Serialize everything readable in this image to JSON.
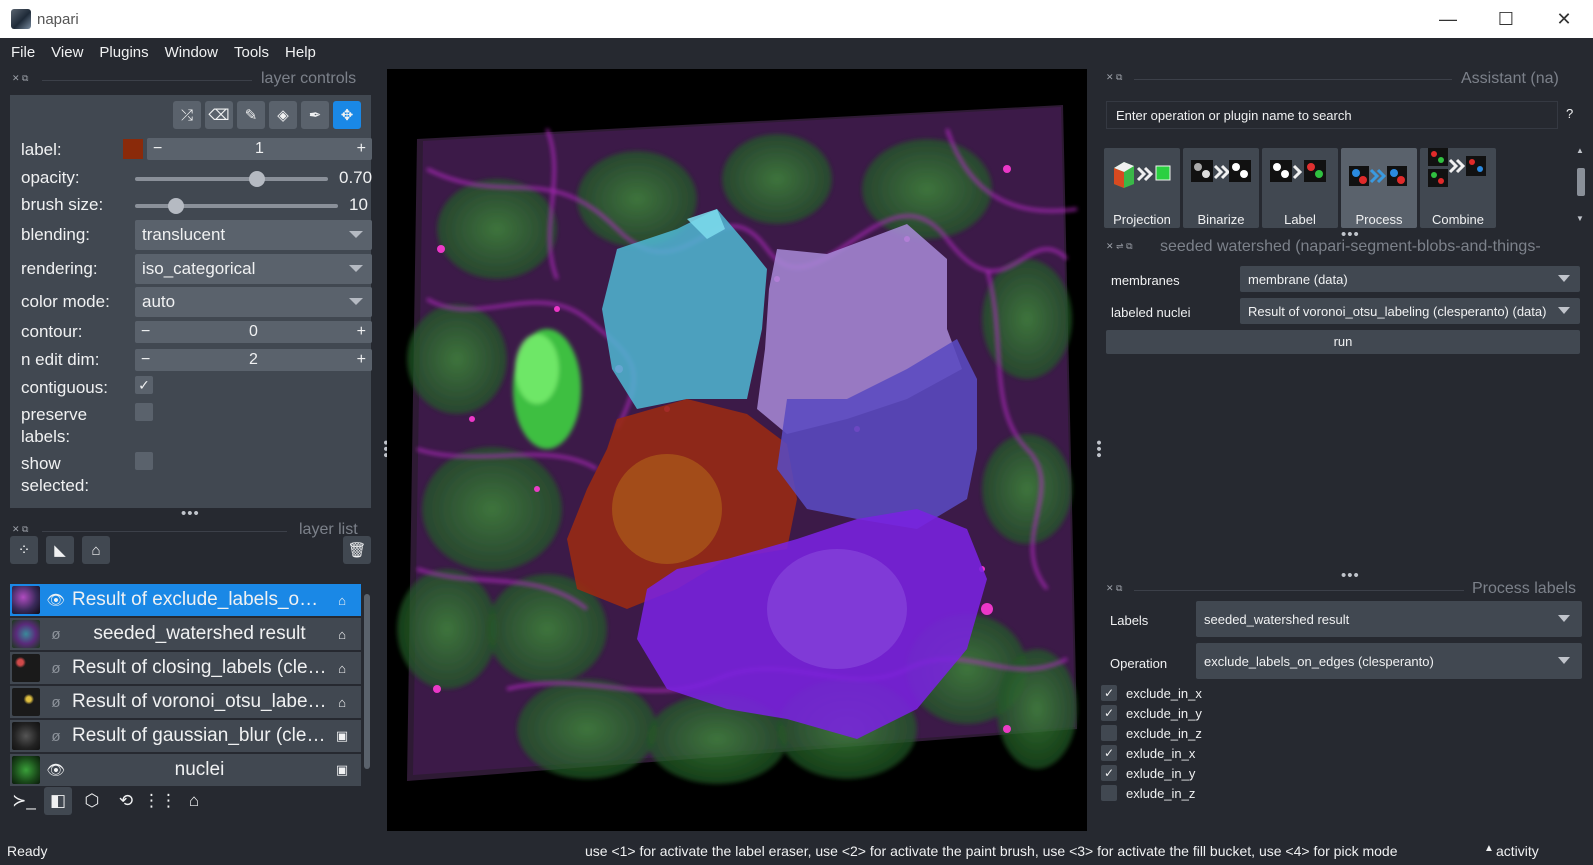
{
  "window": {
    "title": "napari",
    "minimize": "—",
    "maximize": "☐",
    "close": "✕"
  },
  "menu": [
    "File",
    "View",
    "Plugins",
    "Window",
    "Tools",
    "Help"
  ],
  "layer_controls": {
    "title": "layer controls",
    "label": {
      "name": "label:",
      "value": "1",
      "color": "#8a2a0a"
    },
    "opacity": {
      "name": "opacity:",
      "value": "0.70",
      "fraction": 0.7
    },
    "brush_size": {
      "name": "brush size:",
      "value": "10",
      "fraction": 0.2
    },
    "blending": {
      "name": "blending:",
      "value": "translucent"
    },
    "rendering": {
      "name": "rendering:",
      "value": "iso_categorical"
    },
    "color_mode": {
      "name": "color mode:",
      "value": "auto"
    },
    "contour": {
      "name": "contour:",
      "value": "0"
    },
    "n_edit_dim": {
      "name": "n edit dim:",
      "value": "2"
    },
    "contiguous": {
      "name": "contiguous:",
      "checked": true
    },
    "preserve_labels": {
      "name": "preserve\nlabels:",
      "checked": false
    },
    "show_selected": {
      "name": "show\nselected:",
      "checked": false
    }
  },
  "layer_list": {
    "title": "layer list",
    "layers": [
      {
        "name": "Result of exclude_labels_on_...",
        "visible": true,
        "selected": true,
        "type": "labels-icon"
      },
      {
        "name": "seeded_watershed result",
        "visible": false,
        "selected": false,
        "type": "labels-icon"
      },
      {
        "name": "Result of closing_labels (cles...",
        "visible": false,
        "selected": false,
        "type": "labels-icon"
      },
      {
        "name": "Result of voronoi_otsu_label...",
        "visible": false,
        "selected": false,
        "type": "labels-icon"
      },
      {
        "name": "Result of gaussian_blur (cles...",
        "visible": false,
        "selected": false,
        "type": "image-icon"
      },
      {
        "name": "nuclei",
        "visible": true,
        "selected": false,
        "type": "image-icon"
      }
    ]
  },
  "assistant": {
    "title": "Assistant (na)",
    "search_placeholder": "Enter operation or plugin name to search",
    "help": "?",
    "categories": [
      {
        "label": "Projection"
      },
      {
        "label": "Binarize"
      },
      {
        "label": "Label"
      },
      {
        "label": "Process labels"
      },
      {
        "label": "Combine labels"
      }
    ]
  },
  "seeded_watershed": {
    "title": "seeded watershed (napari-segment-blobs-and-things-",
    "membranes_label": "membranes",
    "membranes_value": "membrane (data)",
    "nuclei_label": "labeled nuclei",
    "nuclei_value": "Result of voronoi_otsu_labeling (clesperanto) (data)",
    "run": "run"
  },
  "process_labels": {
    "title": "Process labels",
    "labels_label": "Labels",
    "labels_value": "seeded_watershed result",
    "operation_label": "Operation",
    "operation_value": "exclude_labels_on_edges (clesperanto)",
    "options": [
      {
        "name": "exclude_in_x",
        "checked": true
      },
      {
        "name": "exclude_in_y",
        "checked": true
      },
      {
        "name": "exclude_in_z",
        "checked": false
      },
      {
        "name": "exlude_in_x",
        "checked": true
      },
      {
        "name": "exlude_in_y",
        "checked": true
      },
      {
        "name": "exlude_in_z",
        "checked": false
      }
    ]
  },
  "status": {
    "ready": "Ready",
    "hint": "use <1> for activate the label eraser, use <2> for activate the paint brush, use <3> for activate the fill bucket, use <4> for pick mode",
    "activity": "activity"
  }
}
